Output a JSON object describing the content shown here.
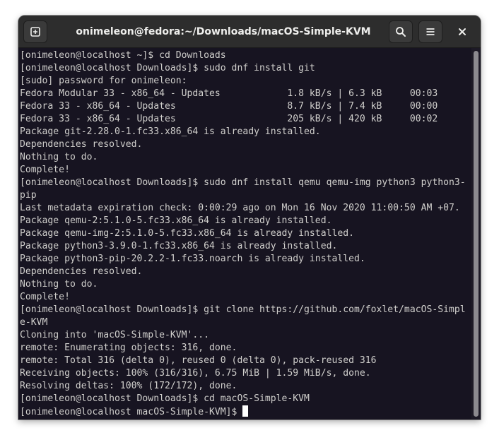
{
  "window": {
    "title": "onimeleon@fedora:~/Downloads/macOS-Simple-KVM"
  },
  "headerbar": {
    "new_tab_icon": "new-tab-icon",
    "search_icon": "search-icon",
    "menu_icon": "hamburger-menu-icon",
    "close_icon": "close-icon"
  },
  "colors": {
    "terminal_bg": "#171421",
    "terminal_fg": "#d0cfcc",
    "headerbar_bg": "#2d2d2d",
    "cursor": "#ffffff"
  },
  "terminal": {
    "lines": [
      "[onimeleon@localhost ~]$ cd Downloads",
      "[onimeleon@localhost Downloads]$ sudo dnf install git",
      "[sudo] password for onimeleon:",
      "Fedora Modular 33 - x86_64 - Updates            1.8 kB/s | 6.3 kB     00:03",
      "Fedora 33 - x86_64 - Updates                    8.7 kB/s | 7.4 kB     00:00",
      "Fedora 33 - x86_64 - Updates                    205 kB/s | 420 kB     00:02",
      "Package git-2.28.0-1.fc33.x86_64 is already installed.",
      "Dependencies resolved.",
      "Nothing to do.",
      "Complete!",
      "[onimeleon@localhost Downloads]$ sudo dnf install qemu qemu-img python3 python3-",
      "pip",
      "Last metadata expiration check: 0:00:29 ago on Mon 16 Nov 2020 11:00:50 AM +07.",
      "Package qemu-2:5.1.0-5.fc33.x86_64 is already installed.",
      "Package qemu-img-2:5.1.0-5.fc33.x86_64 is already installed.",
      "Package python3-3.9.0-1.fc33.x86_64 is already installed.",
      "Package python3-pip-20.2.2-1.fc33.noarch is already installed.",
      "Dependencies resolved.",
      "Nothing to do.",
      "Complete!",
      "[onimeleon@localhost Downloads]$ git clone https://github.com/foxlet/macOS-Simpl",
      "e-KVM",
      "Cloning into 'macOS-Simple-KVM'...",
      "remote: Enumerating objects: 316, done.",
      "remote: Total 316 (delta 0), reused 0 (delta 0), pack-reused 316",
      "Receiving objects: 100% (316/316), 6.75 MiB | 1.59 MiB/s, done.",
      "Resolving deltas: 100% (172/172), done.",
      "[onimeleon@localhost Downloads]$ cd macOS-Simple-KVM"
    ],
    "prompt": "[onimeleon@localhost macOS-Simple-KVM]$ "
  }
}
